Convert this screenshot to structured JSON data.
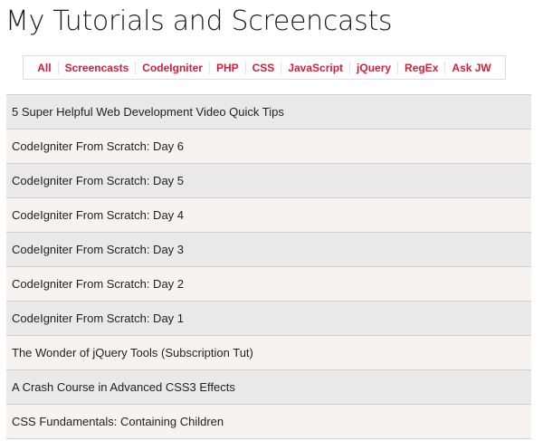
{
  "page_title": "My Tutorials and Screencasts",
  "filters": [
    {
      "label": "All"
    },
    {
      "label": "Screencasts"
    },
    {
      "label": "CodeIgniter"
    },
    {
      "label": "PHP"
    },
    {
      "label": "CSS"
    },
    {
      "label": "JavaScript"
    },
    {
      "label": "jQuery"
    },
    {
      "label": "RegEx"
    },
    {
      "label": "Ask JW"
    }
  ],
  "tutorials": [
    {
      "title": "5 Super Helpful Web Development Video Quick Tips"
    },
    {
      "title": "CodeIgniter From Scratch: Day 6"
    },
    {
      "title": "CodeIgniter From Scratch: Day 5"
    },
    {
      "title": "CodeIgniter From Scratch: Day 4"
    },
    {
      "title": "CodeIgniter From Scratch: Day 3"
    },
    {
      "title": "CodeIgniter From Scratch: Day 2"
    },
    {
      "title": "CodeIgniter From Scratch: Day 1"
    },
    {
      "title": "The Wonder of jQuery Tools (Subscription Tut)"
    },
    {
      "title": "A Crash Course in Advanced CSS3 Effects"
    },
    {
      "title": "CSS Fundamentals: Containing Children"
    }
  ],
  "colors": {
    "filter_link": "#d41c3c",
    "row_odd": "#e9e9e9",
    "row_even": "#f7f3f3"
  }
}
